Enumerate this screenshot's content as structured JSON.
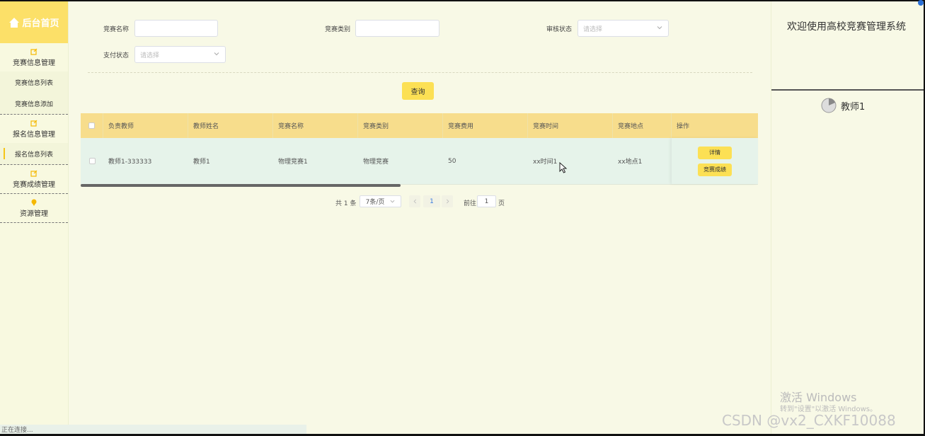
{
  "sidebar": {
    "home_label": "后台首页",
    "groups": [
      {
        "label": "竞赛信息管理",
        "items": [
          "竞赛信息列表",
          "竞赛信息添加"
        ]
      },
      {
        "label": "报名信息管理",
        "items": [
          "报名信息列表"
        ]
      },
      {
        "label": "竞赛成绩管理",
        "items": []
      },
      {
        "label": "资源管理",
        "items": []
      }
    ],
    "active_item": "报名信息列表"
  },
  "search": {
    "name_label": "竞赛名称",
    "type_label": "竞赛类别",
    "audit_label": "审核状态",
    "audit_placeholder": "请选择",
    "pay_label": "支付状态",
    "pay_placeholder": "请选择",
    "query_button": "查询"
  },
  "table": {
    "columns": [
      "负责教师",
      "教师姓名",
      "竞赛名称",
      "竞赛类别",
      "竞赛费用",
      "竞赛时间",
      "竞赛地点",
      "操作"
    ],
    "rows": [
      {
        "cells": [
          "教师1-333333",
          "教师1",
          "物理竞赛1",
          "物理竞赛",
          "50",
          "xx时间1",
          "xx地点1"
        ],
        "actions": [
          "详情",
          "竞赛成绩"
        ]
      }
    ]
  },
  "pagination": {
    "total": "共 1 条",
    "page_size": "7条/页",
    "current_page": "1",
    "goto_label": "前往",
    "goto_value": "1",
    "page_suffix": "页"
  },
  "right_panel": {
    "welcome": "欢迎使用高校竞赛管理系统",
    "user_name": "教师1"
  },
  "watermark": {
    "activate_title": "激活 Windows",
    "activate_sub": "转到\"设置\"以激活 Windows。",
    "csdn": "CSDN @vx2_CXKF10088"
  },
  "status_text": "正在连接..."
}
